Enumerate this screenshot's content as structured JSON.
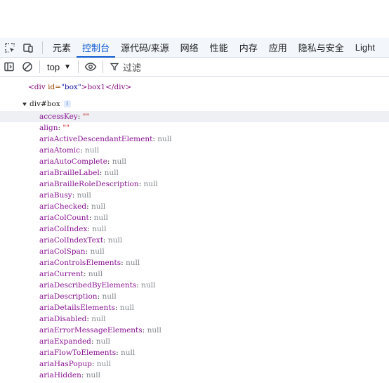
{
  "devtools": {
    "tabs": [
      {
        "label": "元素",
        "active": false
      },
      {
        "label": "控制台",
        "active": true
      },
      {
        "label": "源代码/来源",
        "active": false
      },
      {
        "label": "网络",
        "active": false
      },
      {
        "label": "性能",
        "active": false
      },
      {
        "label": "内存",
        "active": false
      },
      {
        "label": "应用",
        "active": false
      },
      {
        "label": "隐私与安全",
        "active": false
      },
      {
        "label": "Light",
        "active": false
      }
    ],
    "toolbar": {
      "context": "top",
      "filter_placeholder": "过滤"
    }
  },
  "console": {
    "html_output": {
      "open_tag": "<div",
      "attr_name": " id=",
      "attr_value": "\"box\"",
      "content": ">box1",
      "close_tag": "</div>"
    },
    "object": {
      "header": "div#box",
      "info_badge": "i",
      "properties": [
        {
          "key": "accessKey",
          "value": "\"\"",
          "type": "string"
        },
        {
          "key": "align",
          "value": "\"\"",
          "type": "string"
        },
        {
          "key": "ariaActiveDescendantElement",
          "value": "null",
          "type": "null"
        },
        {
          "key": "ariaAtomic",
          "value": "null",
          "type": "null"
        },
        {
          "key": "ariaAutoComplete",
          "value": "null",
          "type": "null"
        },
        {
          "key": "ariaBrailleLabel",
          "value": "null",
          "type": "null"
        },
        {
          "key": "ariaBrailleRoleDescription",
          "value": "null",
          "type": "null"
        },
        {
          "key": "ariaBusy",
          "value": "null",
          "type": "null"
        },
        {
          "key": "ariaChecked",
          "value": "null",
          "type": "null"
        },
        {
          "key": "ariaColCount",
          "value": "null",
          "type": "null"
        },
        {
          "key": "ariaColIndex",
          "value": "null",
          "type": "null"
        },
        {
          "key": "ariaColIndexText",
          "value": "null",
          "type": "null"
        },
        {
          "key": "ariaColSpan",
          "value": "null",
          "type": "null"
        },
        {
          "key": "ariaControlsElements",
          "value": "null",
          "type": "null"
        },
        {
          "key": "ariaCurrent",
          "value": "null",
          "type": "null"
        },
        {
          "key": "ariaDescribedByElements",
          "value": "null",
          "type": "null"
        },
        {
          "key": "ariaDescription",
          "value": "null",
          "type": "null"
        },
        {
          "key": "ariaDetailsElements",
          "value": "null",
          "type": "null"
        },
        {
          "key": "ariaDisabled",
          "value": "null",
          "type": "null"
        },
        {
          "key": "ariaErrorMessageElements",
          "value": "null",
          "type": "null"
        },
        {
          "key": "ariaExpanded",
          "value": "null",
          "type": "null"
        },
        {
          "key": "ariaFlowToElements",
          "value": "null",
          "type": "null"
        },
        {
          "key": "ariaHasPopup",
          "value": "null",
          "type": "null"
        },
        {
          "key": "ariaHidden",
          "value": "null",
          "type": "null"
        }
      ]
    }
  },
  "colors": {
    "accent": "#0b57d0",
    "prop_key": "#881391",
    "null_value": "#80868b",
    "string_value": "#c41a16"
  }
}
